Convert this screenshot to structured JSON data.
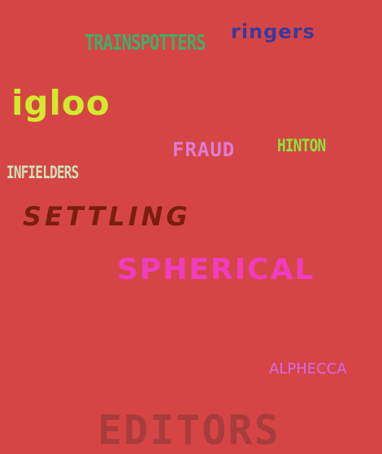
{
  "colors": {
    "background": "#d64545",
    "trainspotters": "#3fae68",
    "ringers": "#3a3a9a",
    "igloo": "#d2ea2e",
    "fraud": "#e07ad6",
    "hinton": "#8ee23a",
    "infielders": "#cfe0b8",
    "settling": "#7a1e12",
    "spherical": "#f03cc0",
    "alphecca": "#d46ae6",
    "editors": "#a83c3c"
  },
  "words": {
    "trainspotters": "TRAINSPOTTERS",
    "ringers": "ringers",
    "igloo": "igloo",
    "fraud": "FRAUD",
    "hinton": "HINTON",
    "infielders": "INFIELDERS",
    "settling": "SETTLING",
    "spherical": "SPHERICAL",
    "alphecca": "ALPHECCA",
    "editors": "EDITORS"
  }
}
